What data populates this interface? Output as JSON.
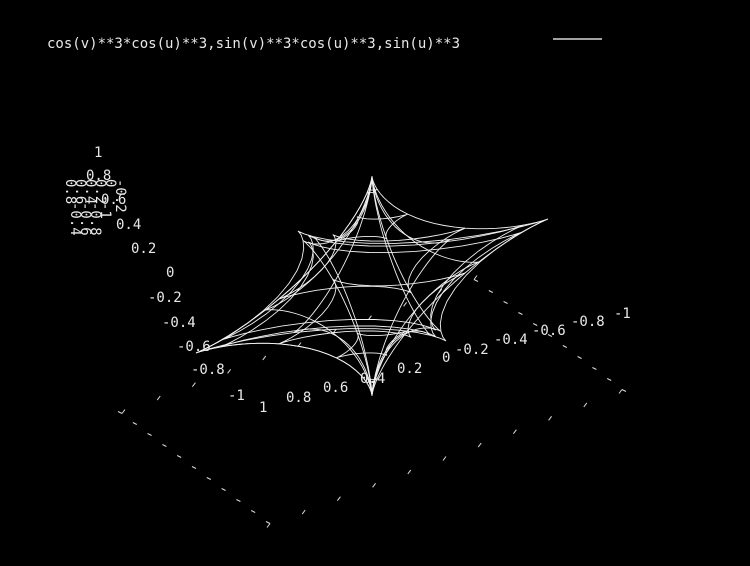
{
  "chart_data": {
    "type": "surface",
    "style": "wireframe 3D parametric surface (gnuplot-style)",
    "legend": {
      "entries": [
        "cos(v)**3*cos(u)**3,sin(v)**3*cos(u)**3,sin(u)**3"
      ],
      "position": "top-left",
      "color": "#ffffff"
    },
    "parametric": {
      "x": "cos(v)**3*cos(u)**3",
      "y": "sin(v)**3*cos(u)**3",
      "z": "sin(u)**3",
      "u_range": [
        -1.5708,
        1.5708
      ],
      "v_range": [
        0,
        6.2832
      ]
    },
    "xlim": [
      -1,
      1
    ],
    "ylim": [
      -1,
      1
    ],
    "zlim": [
      -1,
      1
    ],
    "ticks": {
      "front_axis": [
        "1",
        "0.8",
        "0.6",
        "0.4",
        "0.2",
        "0",
        "-0.2",
        "-0.4",
        "-0.6",
        "-0.8",
        "-1"
      ],
      "left_axis": [
        "-1",
        "-0.8",
        "-0.6",
        "-0.4",
        "-0.2",
        "0",
        "0.2",
        "0.4",
        "0.6",
        "0.8",
        "1"
      ],
      "z_axis_label": "1",
      "z_axis_overlap": [
        "0.8",
        "0.6",
        "0.4",
        "0.2",
        "0",
        "-0.2",
        "-0.4",
        "-0.6",
        "-0.8",
        "-1"
      ]
    },
    "grid": false,
    "colors": {
      "background": "#000000",
      "lines": "#ffffff"
    }
  }
}
